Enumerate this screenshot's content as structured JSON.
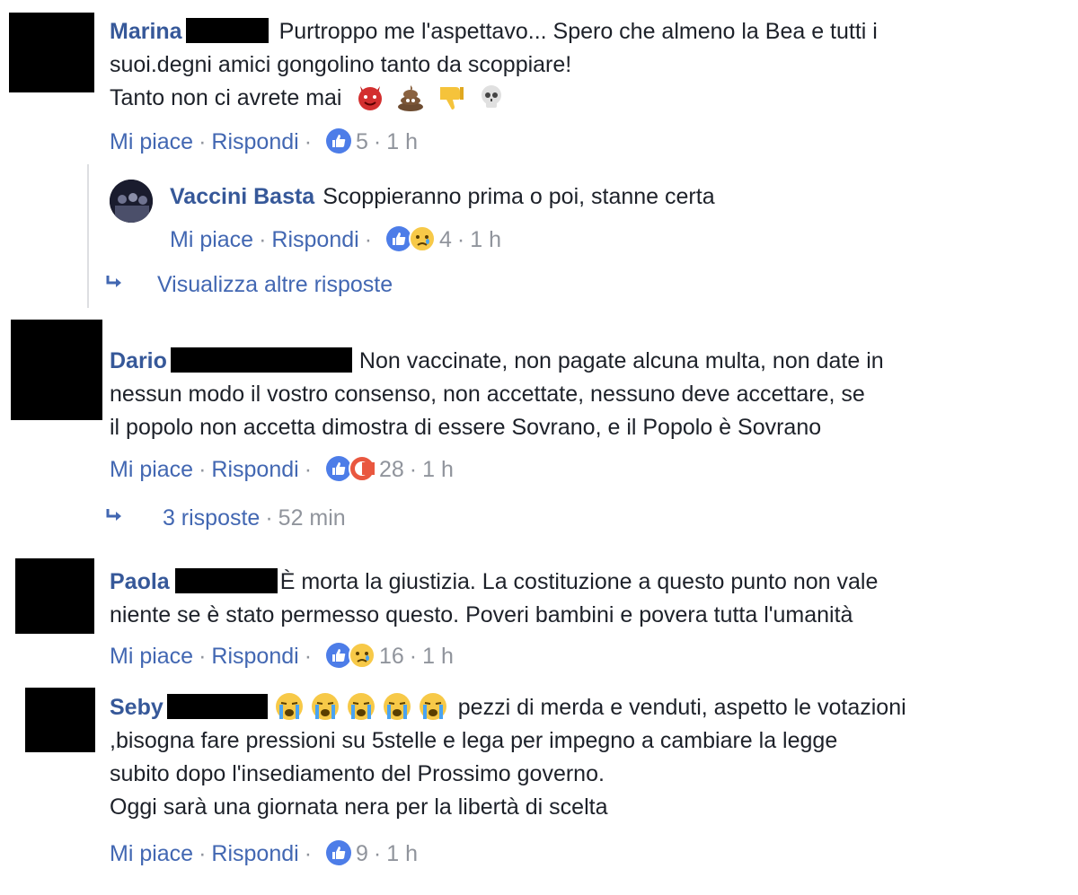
{
  "comments": [
    {
      "author": "Marina",
      "text_line1": "Purtroppo me l'aspettavo... Spero che almeno la Bea e tutti i",
      "text_line2": "suoi.degni amici gongolino tanto da scoppiare!",
      "text_line3": "Tanto non ci avrete mai",
      "like_label": "Mi piace",
      "reply_label": "Rispondi",
      "reaction_count": "5",
      "time": "1 h",
      "emojis": [
        "devil-emoji",
        "poop-emoji",
        "thumbs-down-emoji",
        "skull-emoji"
      ]
    },
    {
      "author": "Dario",
      "text_line1": "Non vaccinate, non pagate alcuna multa, non date in",
      "text_line2": "nessun modo il vostro consenso, non accettate, nessuno deve accettare, se",
      "text_line3": "il popolo non accetta dimostra di essere Sovrano, e il Popolo è Sovrano",
      "like_label": "Mi piace",
      "reply_label": "Rispondi",
      "reaction_count": "28",
      "time": "1 h"
    },
    {
      "author": "Paola",
      "text_line1": "È morta la giustizia. La costituzione a questo punto non vale",
      "text_line2": "niente se è stato permesso questo. Poveri bambini e povera tutta l'umanità",
      "like_label": "Mi piace",
      "reply_label": "Rispondi",
      "reaction_count": "16",
      "time": "1 h"
    },
    {
      "author": "Seby",
      "text_line1": "pezzi di merda e venduti, aspetto le votazioni",
      "text_line2": ",bisogna fare pressioni su 5stelle e lega per impegno a cambiare la legge",
      "text_line3": "subito dopo l'insediamento del Prossimo governo.",
      "text_line4": "Oggi sarà una giornata nera per la libertà di scelta",
      "like_label": "Mi piace",
      "reply_label": "Rispondi",
      "reaction_count": "9",
      "time": "1 h",
      "emojis": [
        "crying-emoji",
        "crying-emoji",
        "crying-emoji",
        "crying-emoji",
        "crying-emoji"
      ]
    }
  ],
  "reply": {
    "author": "Vaccini Basta",
    "text": "Scoppieranno prima o poi, stanne certa",
    "like_label": "Mi piace",
    "reply_label": "Rispondi",
    "reaction_count": "4",
    "time": "1 h"
  },
  "more_replies_label": "Visualizza altre risposte",
  "dario_replies": {
    "label": "3 risposte",
    "time": "52 min"
  },
  "separator": "·",
  "colors": {
    "link": "#4267b2",
    "author": "#365899",
    "meta": "#90949c",
    "text": "#1d2129"
  }
}
